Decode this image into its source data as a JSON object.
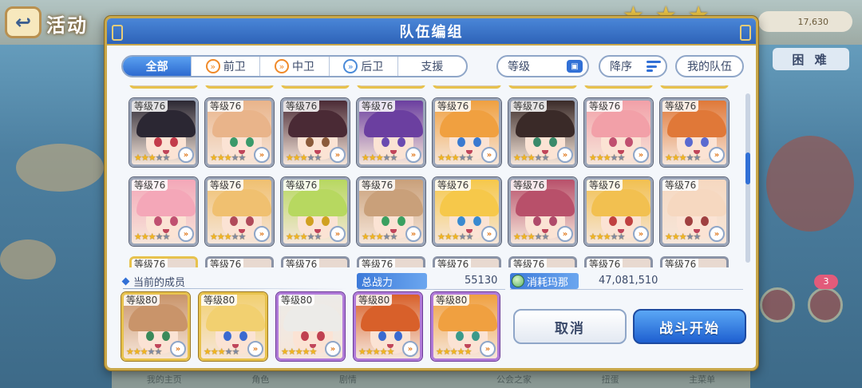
{
  "background": {
    "title": "活动",
    "gold": "17,630",
    "difficulty": "困 难",
    "badge": "3",
    "bottom_tabs": [
      "我的主页",
      "角色",
      "剧情",
      "",
      "公会之家",
      "扭蛋",
      "主菜单"
    ]
  },
  "modal": {
    "title": "队伍编组",
    "tabs": [
      {
        "label": "全部",
        "active": true,
        "icon": ""
      },
      {
        "label": "前卫",
        "active": false,
        "icon": "front-icon"
      },
      {
        "label": "中卫",
        "active": false,
        "icon": "middle-icon"
      },
      {
        "label": "后卫",
        "active": false,
        "icon": "back-icon"
      },
      {
        "label": "支援",
        "active": false,
        "icon": ""
      }
    ],
    "sort_level_label": "等级",
    "sort_order_label": "降序",
    "my_team_label": "我的队伍"
  },
  "roster": {
    "level_prefix": "等级76",
    "cards": [
      {
        "hair": "#2b2733",
        "eye": "#c33b4a",
        "frame": "silver",
        "stars": 3
      },
      {
        "hair": "#e9b48a",
        "eye": "#3a9a6a",
        "frame": "silver",
        "stars": 3
      },
      {
        "hair": "#4a2a35",
        "eye": "#8a5a3a",
        "frame": "silver",
        "stars": 3
      },
      {
        "hair": "#6b3fa0",
        "eye": "#6a4ab0",
        "frame": "silver",
        "stars": 3
      },
      {
        "hair": "#f0a040",
        "eye": "#3a7ad0",
        "frame": "silver",
        "stars": 3
      },
      {
        "hair": "#3a2a28",
        "eye": "#3a8a6a",
        "frame": "silver",
        "stars": 3
      },
      {
        "hair": "#f2a0a8",
        "eye": "#c05070",
        "frame": "silver",
        "stars": 3
      },
      {
        "hair": "#e07838",
        "eye": "#5a6ad0",
        "frame": "silver",
        "stars": 3
      },
      {
        "hair": "#f4a7b8",
        "eye": "#c05070",
        "frame": "silver",
        "stars": 3
      },
      {
        "hair": "#f0c070",
        "eye": "#b04a5a",
        "frame": "silver",
        "stars": 3
      },
      {
        "hair": "#b7d860",
        "eye": "#d0a020",
        "frame": "silver",
        "stars": 3
      },
      {
        "hair": "#c9a07a",
        "eye": "#3aa060",
        "frame": "silver",
        "stars": 3
      },
      {
        "hair": "#f6c84a",
        "eye": "#3a8ad0",
        "frame": "silver",
        "stars": 3
      },
      {
        "hair": "#b8506a",
        "eye": "#b04a6a",
        "frame": "silver",
        "stars": 3
      },
      {
        "hair": "#f2c050",
        "eye": "#c04040",
        "frame": "silver",
        "stars": 3
      },
      {
        "hair": "#f6d8c0",
        "eye": "#a04040",
        "frame": "silver",
        "stars": 3
      }
    ],
    "partial_row_label": "等级76"
  },
  "team": {
    "label": "当前的成员",
    "level_prefix": "等级80",
    "members": [
      {
        "hair": "#c9946a",
        "eye": "#3a8a5a",
        "frame": "gold",
        "stars": 3
      },
      {
        "hair": "#f2d070",
        "eye": "#3a6ad0",
        "frame": "gold",
        "stars": 3
      },
      {
        "hair": "#ecebe8",
        "eye": "#c04050",
        "frame": "purple",
        "stars": 5
      },
      {
        "hair": "#d8602a",
        "eye": "#3a6ad0",
        "frame": "purple",
        "stars": 5
      },
      {
        "hair": "#f0a040",
        "eye": "#3a9a8a",
        "frame": "purple",
        "stars": 5
      }
    ]
  },
  "stats": {
    "power_label": "总战力",
    "power_value": "55130",
    "mana_label": "消耗玛那",
    "mana_value": "47,081,510"
  },
  "buttons": {
    "cancel": "取消",
    "start": "战斗开始"
  },
  "colors": {
    "accent": "#3170d6",
    "frame_gold": "#e7c24d",
    "frame_purple": "#b07ad8",
    "frame_silver": "#9ba5b8"
  }
}
